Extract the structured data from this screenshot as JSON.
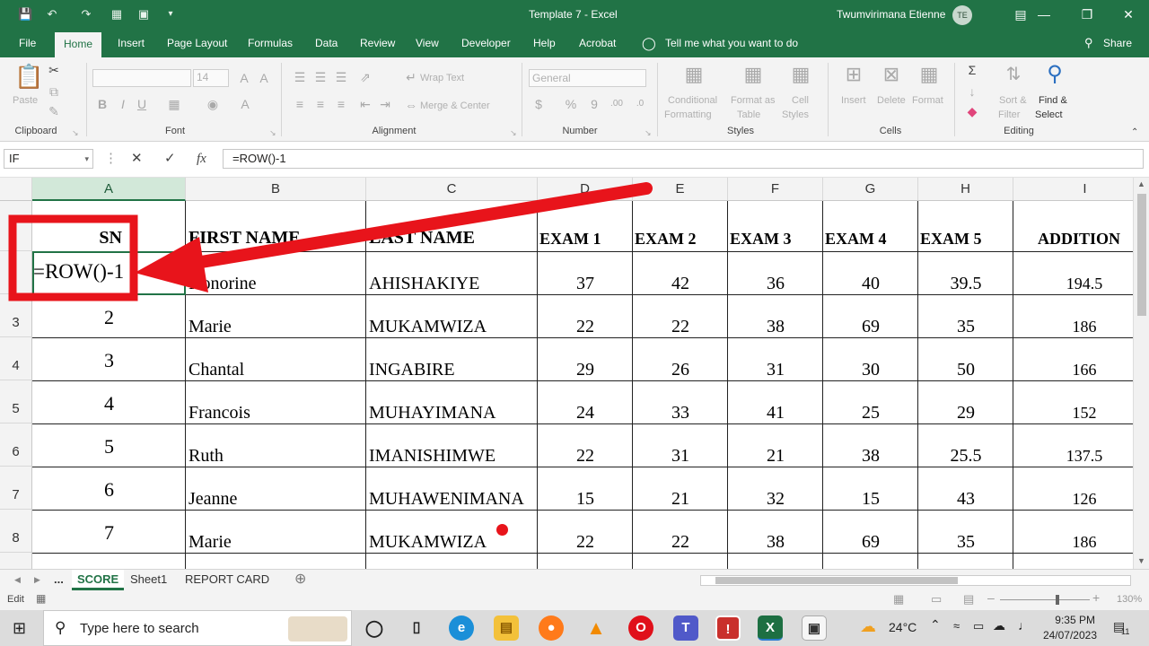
{
  "window": {
    "title": "Template 7  -  Excel",
    "user": "Twumvirimana Etienne",
    "initials": "TE"
  },
  "ribbon_tabs": [
    "File",
    "Home",
    "Insert",
    "Page Layout",
    "Formulas",
    "Data",
    "Review",
    "View",
    "Developer",
    "Help",
    "Acrobat"
  ],
  "tell_me": "Tell me what you want to do",
  "share": "Share",
  "ribbon": {
    "paste": "Paste",
    "font_size": "14",
    "bold": "B",
    "italic": "I",
    "underline": "U",
    "wrap_text": "Wrap Text",
    "merge_center": "Merge & Center",
    "number_format": "General",
    "conditional": "Conditional",
    "formatting": "Formatting",
    "format_as": "Format as",
    "table": "Table",
    "cell": "Cell",
    "styles_btn": "Styles",
    "insert": "Insert",
    "delete": "Delete",
    "format": "Format",
    "sort": "Sort &",
    "filter": "Filter",
    "find": "Find &",
    "select": "Select",
    "groups": {
      "clipboard": "Clipboard",
      "font": "Font",
      "alignment": "Alignment",
      "number": "Number",
      "styles": "Styles",
      "cells": "Cells",
      "editing": "Editing"
    }
  },
  "formula_bar": {
    "name_box": "IF",
    "formula": "=ROW()-1"
  },
  "columns": [
    "A",
    "B",
    "C",
    "D",
    "E",
    "F",
    "G",
    "H",
    "I"
  ],
  "rows": [
    "3",
    "4",
    "5",
    "6",
    "7",
    "8"
  ],
  "headers": [
    "SN",
    "FIRST NAME",
    "LAST NAME",
    "EXAM 1",
    "EXAM 2",
    "EXAM 3",
    "EXAM 4",
    "EXAM 5",
    "ADDITION"
  ],
  "editing_cell": "=ROW()-1",
  "data_rows": [
    {
      "sn": "",
      "first": "Honorine",
      "last": "AHISHAKIYE",
      "e1": "37",
      "e2": "42",
      "e3": "36",
      "e4": "40",
      "e5": "39.5",
      "add": "194.5"
    },
    {
      "sn": "2",
      "first": "Marie",
      "last": "MUKAMWIZA",
      "e1": "22",
      "e2": "22",
      "e3": "38",
      "e4": "69",
      "e5": "35",
      "add": "186"
    },
    {
      "sn": "3",
      "first": "Chantal",
      "last": "INGABIRE",
      "e1": "29",
      "e2": "26",
      "e3": "31",
      "e4": "30",
      "e5": "50",
      "add": "166"
    },
    {
      "sn": "4",
      "first": "Francois",
      "last": "MUHAYIMANA",
      "e1": "24",
      "e2": "33",
      "e3": "41",
      "e4": "25",
      "e5": "29",
      "add": "152"
    },
    {
      "sn": "5",
      "first": "Ruth",
      "last": "IMANISHIMWE",
      "e1": "22",
      "e2": "31",
      "e3": "21",
      "e4": "38",
      "e5": "25.5",
      "add": "137.5"
    },
    {
      "sn": "6",
      "first": "Jeanne",
      "last": "MUHAWENIMANA",
      "e1": "15",
      "e2": "21",
      "e3": "32",
      "e4": "15",
      "e5": "43",
      "add": "126"
    },
    {
      "sn": "7",
      "first": "Marie",
      "last": "MUKAMWIZA",
      "e1": "22",
      "e2": "22",
      "e3": "38",
      "e4": "69",
      "e5": "35",
      "add": "186"
    }
  ],
  "sheets": {
    "more": "...",
    "tabs": [
      "SCORE",
      "Sheet1",
      "REPORT CARD"
    ]
  },
  "status": {
    "mode": "Edit",
    "zoom": "130%"
  },
  "taskbar": {
    "search_placeholder": "Type here to search",
    "temperature": "24°C",
    "time": "9:35 PM",
    "date": "24/07/2023",
    "notifications": "11"
  },
  "colors": {
    "excel_green": "#217346",
    "annotation_red": "#e8141b"
  }
}
